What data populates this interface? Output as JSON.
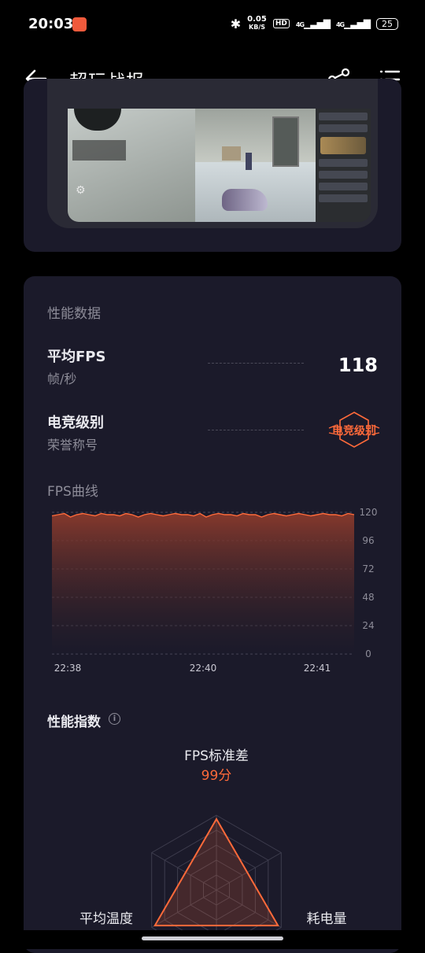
{
  "status_bar": {
    "time": "20:03",
    "speed_value": "0.05",
    "speed_unit": "KB/S",
    "hd": "HD",
    "net1": "4G",
    "net2": "4G",
    "battery": "25"
  },
  "app_bar": {
    "title": "超玩战报",
    "back_icon": "arrow-left-icon",
    "share_icon": "share-icon",
    "menu_icon": "list-menu-icon"
  },
  "performance": {
    "section_title": "性能数据",
    "avg_fps_label": "平均FPS",
    "avg_fps_unit": "帧/秒",
    "avg_fps_value": "118",
    "esports_label": "电竞级别",
    "esports_sub": "荣誉称号",
    "esports_badge": "电竞级别",
    "accent_color": "#ff6a3a"
  },
  "chart_data": {
    "type": "area",
    "title": "FPS曲线",
    "x_ticks": [
      "22:38",
      "22:40",
      "22:41"
    ],
    "y_ticks": [
      120,
      96,
      72,
      48,
      24,
      0
    ],
    "ylim": [
      0,
      120
    ],
    "grid": true,
    "series": [
      {
        "values": [
          117,
          118,
          119,
          116,
          118,
          119,
          118,
          117,
          119,
          118,
          118,
          117,
          119,
          118,
          116,
          118,
          119,
          118,
          117,
          118,
          119,
          118,
          118,
          117,
          119,
          116,
          118,
          119,
          118,
          118,
          117,
          119,
          118,
          118,
          116,
          118,
          119,
          118,
          117,
          118,
          119,
          118,
          117,
          118,
          119,
          118,
          118,
          117,
          119,
          118
        ]
      }
    ]
  },
  "perf_index": {
    "title": "性能指数",
    "info_icon": "info-circle-icon",
    "axes": [
      {
        "label": "FPS标准差",
        "score": "99分"
      },
      {
        "label": "耗电量",
        "score": ""
      },
      {
        "label": "平均温度",
        "score": ""
      }
    ],
    "radar_values": [
      0.95,
      0.95,
      0.95
    ]
  }
}
